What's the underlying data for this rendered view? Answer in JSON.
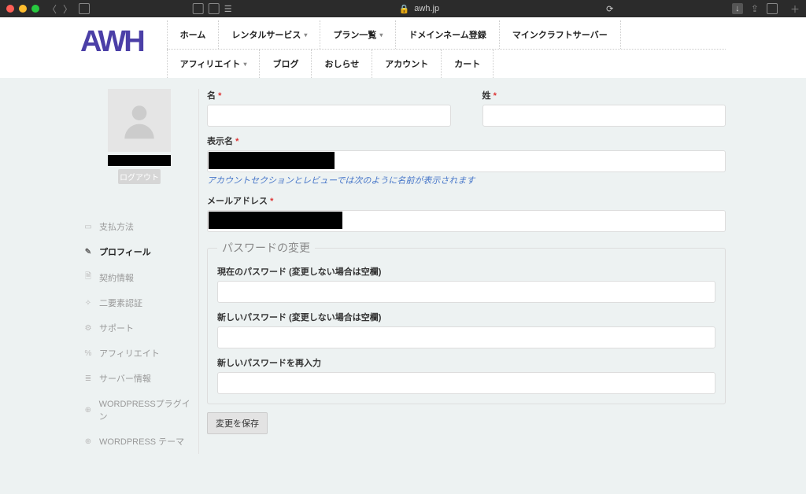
{
  "browser": {
    "url": "awh.jp"
  },
  "logo": "AWH",
  "nav": {
    "row1": [
      {
        "label": "ホーム",
        "hasSub": false
      },
      {
        "label": "レンタルサービス",
        "hasSub": true
      },
      {
        "label": "プラン一覧",
        "hasSub": true
      },
      {
        "label": "ドメインネーム登録",
        "hasSub": false
      },
      {
        "label": "マインクラフトサーバー",
        "hasSub": false
      }
    ],
    "row2": [
      {
        "label": "アフィリエイト",
        "hasSub": true
      },
      {
        "label": "ブログ",
        "hasSub": false
      },
      {
        "label": "おしらせ",
        "hasSub": false
      },
      {
        "label": "アカウント",
        "hasSub": false
      },
      {
        "label": "カート",
        "hasSub": false
      }
    ]
  },
  "sidebar": {
    "logout": "ログアウト",
    "items": [
      {
        "icon": "▭",
        "label": "支払方法",
        "name": "payment-method"
      },
      {
        "icon": "✎",
        "label": "プロフィール",
        "name": "profile",
        "active": true
      },
      {
        "icon": "🗎",
        "label": "契約情報",
        "name": "contract-info"
      },
      {
        "icon": "✧",
        "label": "二要素認証",
        "name": "two-factor-auth"
      },
      {
        "icon": "⚙",
        "label": "サポート",
        "name": "support"
      },
      {
        "icon": "%",
        "label": "アフィリエイト",
        "name": "affiliate"
      },
      {
        "icon": "≣",
        "label": "サーバー情報",
        "name": "server-info"
      },
      {
        "icon": "⊕",
        "label": "WORDPRESSプラグイン",
        "name": "wp-plugin"
      },
      {
        "icon": "⊕",
        "label": "WORDPRESS テーマ",
        "name": "wp-theme"
      }
    ]
  },
  "form": {
    "first_name_label": "名",
    "last_name_label": "姓",
    "display_name_label": "表示名",
    "display_name_helper": "アカウントセクションとレビューでは次のように名前が表示されます",
    "email_label": "メールアドレス",
    "password_section": "パスワードの変更",
    "current_pw_label": "現在のパスワード (変更しない場合は空欄)",
    "new_pw_label": "新しいパスワード (変更しない場合は空欄)",
    "confirm_pw_label": "新しいパスワードを再入力",
    "save": "変更を保存"
  }
}
